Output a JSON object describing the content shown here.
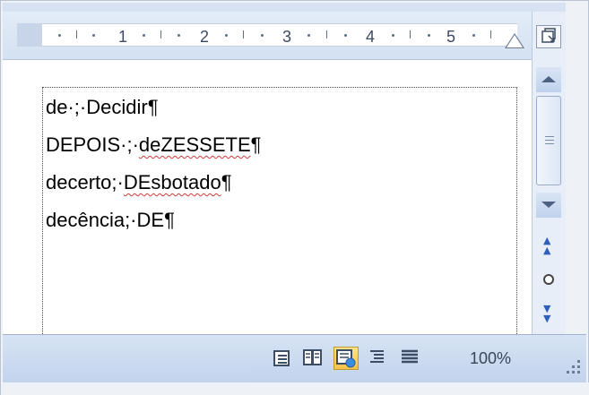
{
  "ruler": {
    "numbers": [
      "1",
      "2",
      "3",
      "4",
      "5"
    ]
  },
  "document": {
    "lines": [
      {
        "parts": [
          "de·;·Decidir",
          "¶"
        ]
      },
      {
        "parts": [
          "DEPOIS·;·",
          "deZESSETE",
          "¶"
        ]
      },
      {
        "parts": [
          "decerto;·",
          "DEsbotado",
          "¶"
        ]
      },
      {
        "parts": [
          "decência;·DE",
          "¶"
        ]
      }
    ]
  },
  "scrollbar": {
    "ruler_toggle_icon": "view-ruler-icon",
    "prev_page_icon": "double-up-arrow-icon",
    "browse_object_icon": "select-browse-object-icon",
    "next_page_icon": "double-down-arrow-icon"
  },
  "status_bar": {
    "view_buttons": [
      {
        "name": "print-layout-view",
        "icon": "print-layout-icon"
      },
      {
        "name": "full-screen-reading-view",
        "icon": "full-screen-reading-icon"
      },
      {
        "name": "web-layout-view",
        "icon": "web-layout-icon",
        "active": true
      },
      {
        "name": "outline-view",
        "icon": "outline-icon"
      },
      {
        "name": "draft-view",
        "icon": "draft-icon"
      }
    ],
    "zoom": "100%"
  },
  "colors": {
    "spellcheck_underline": "#d23a3a",
    "active_view": "#f7c14b",
    "chrome_blue": "#c2d3ec"
  }
}
